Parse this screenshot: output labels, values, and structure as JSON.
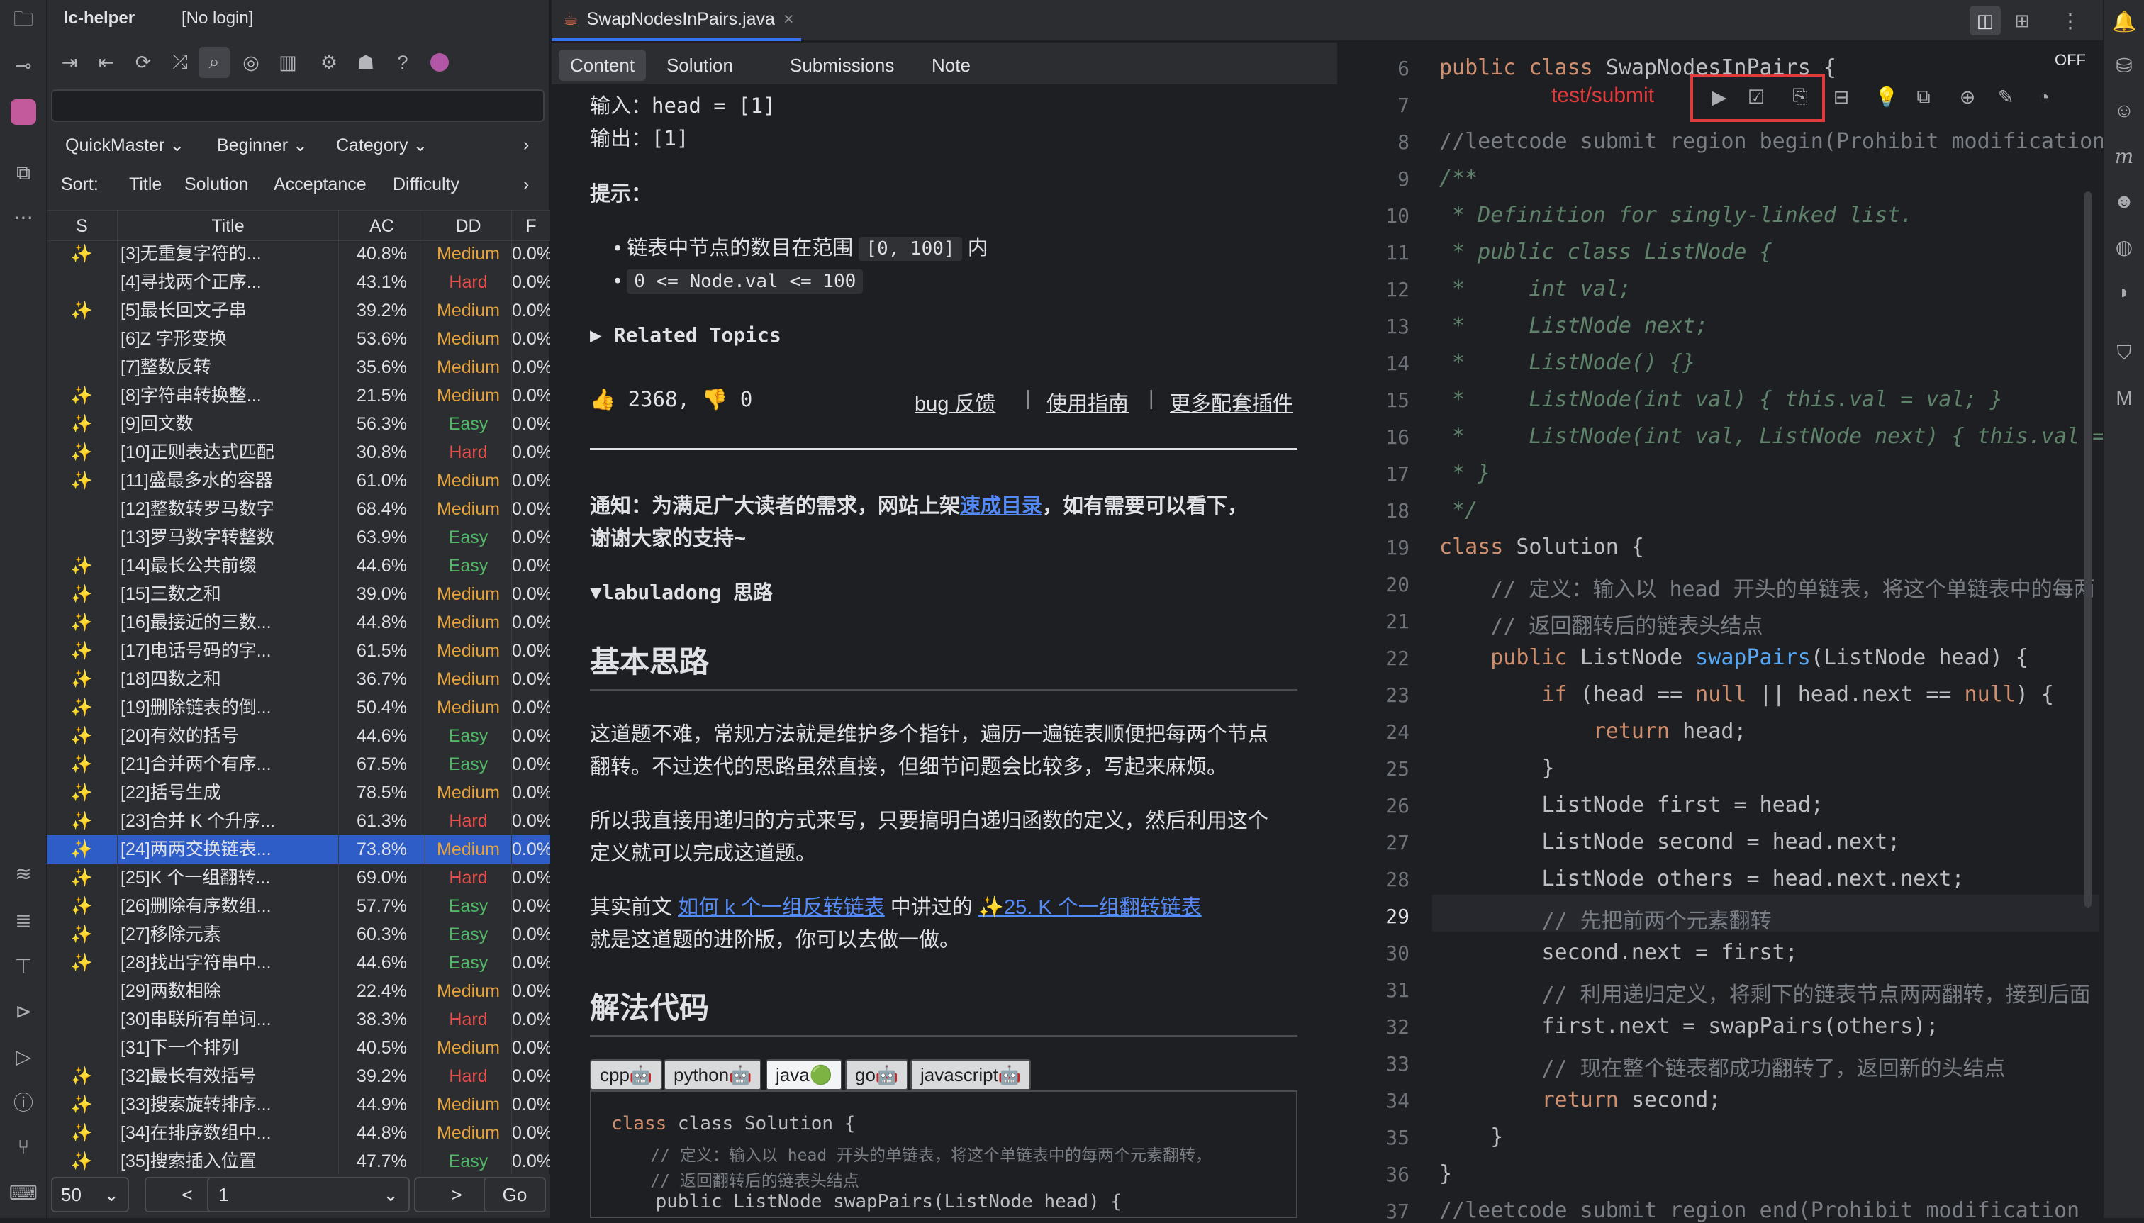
{
  "app": {
    "name": "lc-helper",
    "login": "[No login]"
  },
  "toolbar": {
    "icons": [
      "login-icon",
      "logout-icon",
      "refresh-icon",
      "shuffle-icon",
      "search-icon",
      "target-icon",
      "chart-icon",
      "settings-icon",
      "bug-icon",
      "help-icon",
      "donate-icon"
    ]
  },
  "filters": {
    "quickmaster": "QuickMaster",
    "level": "Beginner",
    "category": "Category",
    "chevron": "›"
  },
  "sort": {
    "label": "Sort:",
    "title": "Title",
    "solution": "Solution",
    "acceptance": "Acceptance",
    "difficulty": "Difficulty"
  },
  "table": {
    "headers": [
      "S",
      "Title",
      "AC",
      "DD",
      "F"
    ],
    "rows": [
      {
        "s": "✨",
        "title": "[3]无重复字符的...",
        "ac": "40.8%",
        "dd": "Medium",
        "f": "0.0%"
      },
      {
        "s": "",
        "title": "[4]寻找两个正序...",
        "ac": "43.1%",
        "dd": "Hard",
        "f": "0.0%"
      },
      {
        "s": "✨",
        "title": "[5]最长回文子串",
        "ac": "39.2%",
        "dd": "Medium",
        "f": "0.0%"
      },
      {
        "s": "",
        "title": "[6]Z 字形变换",
        "ac": "53.6%",
        "dd": "Medium",
        "f": "0.0%"
      },
      {
        "s": "",
        "title": "[7]整数反转",
        "ac": "35.6%",
        "dd": "Medium",
        "f": "0.0%"
      },
      {
        "s": "✨",
        "title": "[8]字符串转换整...",
        "ac": "21.5%",
        "dd": "Medium",
        "f": "0.0%"
      },
      {
        "s": "✨",
        "title": "[9]回文数",
        "ac": "56.3%",
        "dd": "Easy",
        "f": "0.0%"
      },
      {
        "s": "✨",
        "title": "[10]正则表达式匹配",
        "ac": "30.8%",
        "dd": "Hard",
        "f": "0.0%"
      },
      {
        "s": "✨",
        "title": "[11]盛最多水的容器",
        "ac": "61.0%",
        "dd": "Medium",
        "f": "0.0%"
      },
      {
        "s": "",
        "title": "[12]整数转罗马数字",
        "ac": "68.4%",
        "dd": "Medium",
        "f": "0.0%"
      },
      {
        "s": "",
        "title": "[13]罗马数字转整数",
        "ac": "63.9%",
        "dd": "Easy",
        "f": "0.0%"
      },
      {
        "s": "✨",
        "title": "[14]最长公共前缀",
        "ac": "44.6%",
        "dd": "Easy",
        "f": "0.0%"
      },
      {
        "s": "✨",
        "title": "[15]三数之和",
        "ac": "39.0%",
        "dd": "Medium",
        "f": "0.0%"
      },
      {
        "s": "✨",
        "title": "[16]最接近的三数...",
        "ac": "44.8%",
        "dd": "Medium",
        "f": "0.0%"
      },
      {
        "s": "✨",
        "title": "[17]电话号码的字...",
        "ac": "61.5%",
        "dd": "Medium",
        "f": "0.0%"
      },
      {
        "s": "✨",
        "title": "[18]四数之和",
        "ac": "36.7%",
        "dd": "Medium",
        "f": "0.0%"
      },
      {
        "s": "✨",
        "title": "[19]删除链表的倒...",
        "ac": "50.4%",
        "dd": "Medium",
        "f": "0.0%"
      },
      {
        "s": "✨",
        "title": "[20]有效的括号",
        "ac": "44.6%",
        "dd": "Easy",
        "f": "0.0%"
      },
      {
        "s": "✨",
        "title": "[21]合并两个有序...",
        "ac": "67.5%",
        "dd": "Easy",
        "f": "0.0%"
      },
      {
        "s": "✨",
        "title": "[22]括号生成",
        "ac": "78.5%",
        "dd": "Medium",
        "f": "0.0%"
      },
      {
        "s": "✨",
        "title": "[23]合并 K 个升序...",
        "ac": "61.3%",
        "dd": "Hard",
        "f": "0.0%"
      },
      {
        "s": "✨",
        "title": "[24]两两交换链表...",
        "ac": "73.8%",
        "dd": "Medium",
        "f": "0.0%",
        "selected": true
      },
      {
        "s": "✨",
        "title": "[25]K 个一组翻转...",
        "ac": "69.0%",
        "dd": "Hard",
        "f": "0.0%"
      },
      {
        "s": "✨",
        "title": "[26]删除有序数组...",
        "ac": "57.7%",
        "dd": "Easy",
        "f": "0.0%"
      },
      {
        "s": "✨",
        "title": "[27]移除元素",
        "ac": "60.3%",
        "dd": "Easy",
        "f": "0.0%"
      },
      {
        "s": "✨",
        "title": "[28]找出字符串中...",
        "ac": "44.6%",
        "dd": "Easy",
        "f": "0.0%"
      },
      {
        "s": "",
        "title": "[29]两数相除",
        "ac": "22.4%",
        "dd": "Medium",
        "f": "0.0%"
      },
      {
        "s": "",
        "title": "[30]串联所有单词...",
        "ac": "38.3%",
        "dd": "Hard",
        "f": "0.0%"
      },
      {
        "s": "",
        "title": "[31]下一个排列",
        "ac": "40.5%",
        "dd": "Medium",
        "f": "0.0%"
      },
      {
        "s": "✨",
        "title": "[32]最长有效括号",
        "ac": "39.2%",
        "dd": "Hard",
        "f": "0.0%"
      },
      {
        "s": "✨",
        "title": "[33]搜索旋转排序...",
        "ac": "44.9%",
        "dd": "Medium",
        "f": "0.0%"
      },
      {
        "s": "✨",
        "title": "[34]在排序数组中...",
        "ac": "44.8%",
        "dd": "Medium",
        "f": "0.0%"
      },
      {
        "s": "✨",
        "title": "[35]搜索插入位置",
        "ac": "47.7%",
        "dd": "Easy",
        "f": "0.0%"
      }
    ]
  },
  "pager": {
    "size": "50",
    "prev": "<",
    "page": "1",
    "next": ">",
    "go": "Go"
  },
  "file_tab": {
    "name": "SwapNodesInPairs.java",
    "close": "×"
  },
  "content_tabs": [
    "Content",
    "Solution",
    "Submissions",
    "Note"
  ],
  "content": {
    "input_line": "输入：head = [1]",
    "output_line": "输出：[1]",
    "hint_title": "提示：",
    "hint1_pre": "链表中节点的数目在范围",
    "hint1_code": "[0, 100]",
    "hint1_post": "内",
    "hint2_code": "0 <= Node.val <= 100",
    "related": "▶ Related Topics",
    "likes": "👍 2368, 👎 0",
    "bug_link": "bug 反馈",
    "guide_link": "使用指南",
    "more_link": "更多配套插件",
    "sep": "|",
    "notice_pre": "通知：为满足广大读者的需求，网站上架",
    "notice_link": "速成目录",
    "notice_post": "，如有需要可以看下，",
    "notice_line2": "谢谢大家的支持~",
    "labuladong": "▼labuladong 思路",
    "h_idea": "基本思路",
    "p1a": "这道题不难，常规方法就是维护多个指针，遍历一遍链表顺便把每两个节点",
    "p1b": "翻转。不过迭代的思路虽然直接，但细节问题会比较多，写起来麻烦。",
    "p2a": "所以我直接用递归的方式来写，只要搞明白递归函数的定义，然后利用这个",
    "p2b": "定义就可以完成这道题。",
    "p3_pre": "其实前文",
    "p3_link1": "如何 k 个一组反转链表",
    "p3_mid": "中讲过的",
    "p3_link2": "✨25. K 个一组翻转链表",
    "p3b": "就是这道题的进阶版，你可以去做一做。",
    "h_code": "解法代码",
    "lang_tabs": [
      "cpp🤖",
      "python🤖",
      "java🟢",
      "go🤖",
      "javascript🤖"
    ],
    "code": [
      "class Solution {",
      "    // 定义：输入以 head 开头的单链表，将这个单链表中的每两个元素翻转，",
      "    // 返回翻转后的链表头结点",
      "    public ListNode swapPairs(ListNode head) {"
    ]
  },
  "editor": {
    "off_label": "OFF",
    "annotation": "test/submit",
    "accent": "#e03a3a",
    "line_numbers": [
      "6",
      "7",
      "8",
      "9",
      "10",
      "11",
      "12",
      "13",
      "14",
      "15",
      "16",
      "17",
      "18",
      "19",
      "20",
      "21",
      "22",
      "23",
      "24",
      "25",
      "26",
      "27",
      "28",
      "29",
      "30",
      "31",
      "32",
      "33",
      "34",
      "35",
      "36",
      "37"
    ],
    "current_line": "29",
    "lines": {
      "l6a": "public class ",
      "l6b": "SwapNodesInPairs {",
      "l8": "//leetcode submit region begin(Prohibit modification",
      "l9": "/**",
      "l10": " * Definition for singly-linked list.",
      "l11": " * public class ListNode {",
      "l12": " *     int val;",
      "l13": " *     ListNode next;",
      "l14": " *     ListNode() {}",
      "l15": " *     ListNode(int val) { this.val = val; }",
      "l16": " *     ListNode(int val, ListNode next) { this.val =",
      "l17": " * }",
      "l18": " */",
      "l19a": "class ",
      "l19b": "Solution {",
      "l20": "    // 定义：输入以 head 开头的单链表，将这个单链表中的每两",
      "l21": "    // 返回翻转后的链表头结点",
      "l22a": "    public ",
      "l22b": "ListNode ",
      "l22c": "swapPairs",
      "l22d": "(ListNode head) {",
      "l23a": "        if ",
      "l23b": "(head == ",
      "l23c": "null",
      " l23d": "",
      "l23e": " || head.next == ",
      "l23f": "null",
      "l23g": ") {",
      "l24a": "            return ",
      "l24b": "head;",
      "l25": "        }",
      "l26": "        ListNode first = head;",
      "l27": "        ListNode second = head.next;",
      "l28": "        ListNode others = head.next.next;",
      "l29": "        // 先把前两个元素翻转",
      "l30": "        second.next = first;",
      "l31": "        // 利用递归定义，将剩下的链表节点两两翻转，接到后面",
      "l32": "        first.next = swapPairs(others);",
      "l33": "        // 现在整个链表都成功翻转了，返回新的头结点",
      "l34a": "        return ",
      "l34b": "second;",
      "l35": "    }",
      "l36": "}",
      "l37": "//leetcode submit region end(Prohibit modification"
    }
  }
}
